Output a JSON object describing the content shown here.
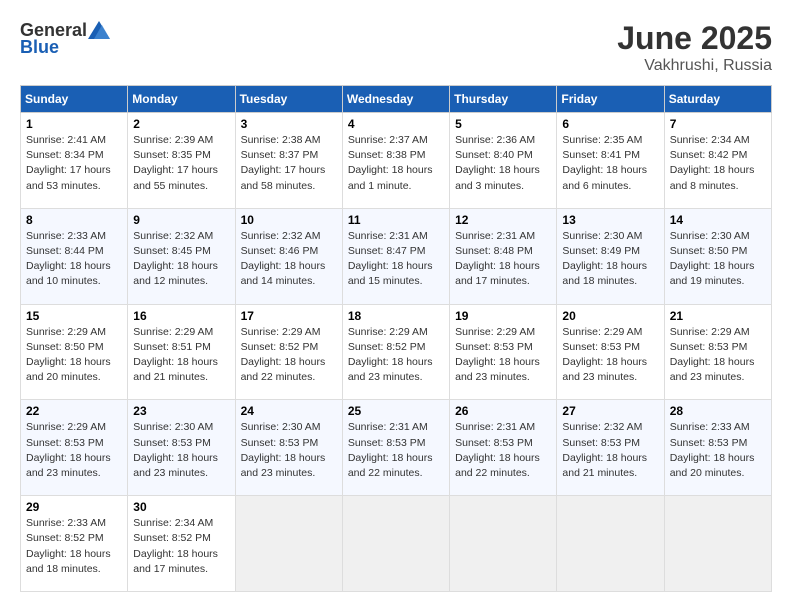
{
  "header": {
    "logo_general": "General",
    "logo_blue": "Blue",
    "month": "June 2025",
    "location": "Vakhrushi, Russia"
  },
  "days_of_week": [
    "Sunday",
    "Monday",
    "Tuesday",
    "Wednesday",
    "Thursday",
    "Friday",
    "Saturday"
  ],
  "weeks": [
    [
      {
        "day": "1",
        "sunrise": "2:41 AM",
        "sunset": "8:34 PM",
        "daylight": "17 hours and 53 minutes."
      },
      {
        "day": "2",
        "sunrise": "2:39 AM",
        "sunset": "8:35 PM",
        "daylight": "17 hours and 55 minutes."
      },
      {
        "day": "3",
        "sunrise": "2:38 AM",
        "sunset": "8:37 PM",
        "daylight": "17 hours and 58 minutes."
      },
      {
        "day": "4",
        "sunrise": "2:37 AM",
        "sunset": "8:38 PM",
        "daylight": "18 hours and 1 minute."
      },
      {
        "day": "5",
        "sunrise": "2:36 AM",
        "sunset": "8:40 PM",
        "daylight": "18 hours and 3 minutes."
      },
      {
        "day": "6",
        "sunrise": "2:35 AM",
        "sunset": "8:41 PM",
        "daylight": "18 hours and 6 minutes."
      },
      {
        "day": "7",
        "sunrise": "2:34 AM",
        "sunset": "8:42 PM",
        "daylight": "18 hours and 8 minutes."
      }
    ],
    [
      {
        "day": "8",
        "sunrise": "2:33 AM",
        "sunset": "8:44 PM",
        "daylight": "18 hours and 10 minutes."
      },
      {
        "day": "9",
        "sunrise": "2:32 AM",
        "sunset": "8:45 PM",
        "daylight": "18 hours and 12 minutes."
      },
      {
        "day": "10",
        "sunrise": "2:32 AM",
        "sunset": "8:46 PM",
        "daylight": "18 hours and 14 minutes."
      },
      {
        "day": "11",
        "sunrise": "2:31 AM",
        "sunset": "8:47 PM",
        "daylight": "18 hours and 15 minutes."
      },
      {
        "day": "12",
        "sunrise": "2:31 AM",
        "sunset": "8:48 PM",
        "daylight": "18 hours and 17 minutes."
      },
      {
        "day": "13",
        "sunrise": "2:30 AM",
        "sunset": "8:49 PM",
        "daylight": "18 hours and 18 minutes."
      },
      {
        "day": "14",
        "sunrise": "2:30 AM",
        "sunset": "8:50 PM",
        "daylight": "18 hours and 19 minutes."
      }
    ],
    [
      {
        "day": "15",
        "sunrise": "2:29 AM",
        "sunset": "8:50 PM",
        "daylight": "18 hours and 20 minutes."
      },
      {
        "day": "16",
        "sunrise": "2:29 AM",
        "sunset": "8:51 PM",
        "daylight": "18 hours and 21 minutes."
      },
      {
        "day": "17",
        "sunrise": "2:29 AM",
        "sunset": "8:52 PM",
        "daylight": "18 hours and 22 minutes."
      },
      {
        "day": "18",
        "sunrise": "2:29 AM",
        "sunset": "8:52 PM",
        "daylight": "18 hours and 23 minutes."
      },
      {
        "day": "19",
        "sunrise": "2:29 AM",
        "sunset": "8:53 PM",
        "daylight": "18 hours and 23 minutes."
      },
      {
        "day": "20",
        "sunrise": "2:29 AM",
        "sunset": "8:53 PM",
        "daylight": "18 hours and 23 minutes."
      },
      {
        "day": "21",
        "sunrise": "2:29 AM",
        "sunset": "8:53 PM",
        "daylight": "18 hours and 23 minutes."
      }
    ],
    [
      {
        "day": "22",
        "sunrise": "2:29 AM",
        "sunset": "8:53 PM",
        "daylight": "18 hours and 23 minutes."
      },
      {
        "day": "23",
        "sunrise": "2:30 AM",
        "sunset": "8:53 PM",
        "daylight": "18 hours and 23 minutes."
      },
      {
        "day": "24",
        "sunrise": "2:30 AM",
        "sunset": "8:53 PM",
        "daylight": "18 hours and 23 minutes."
      },
      {
        "day": "25",
        "sunrise": "2:31 AM",
        "sunset": "8:53 PM",
        "daylight": "18 hours and 22 minutes."
      },
      {
        "day": "26",
        "sunrise": "2:31 AM",
        "sunset": "8:53 PM",
        "daylight": "18 hours and 22 minutes."
      },
      {
        "day": "27",
        "sunrise": "2:32 AM",
        "sunset": "8:53 PM",
        "daylight": "18 hours and 21 minutes."
      },
      {
        "day": "28",
        "sunrise": "2:33 AM",
        "sunset": "8:53 PM",
        "daylight": "18 hours and 20 minutes."
      }
    ],
    [
      {
        "day": "29",
        "sunrise": "2:33 AM",
        "sunset": "8:52 PM",
        "daylight": "18 hours and 18 minutes."
      },
      {
        "day": "30",
        "sunrise": "2:34 AM",
        "sunset": "8:52 PM",
        "daylight": "18 hours and 17 minutes."
      },
      null,
      null,
      null,
      null,
      null
    ]
  ]
}
